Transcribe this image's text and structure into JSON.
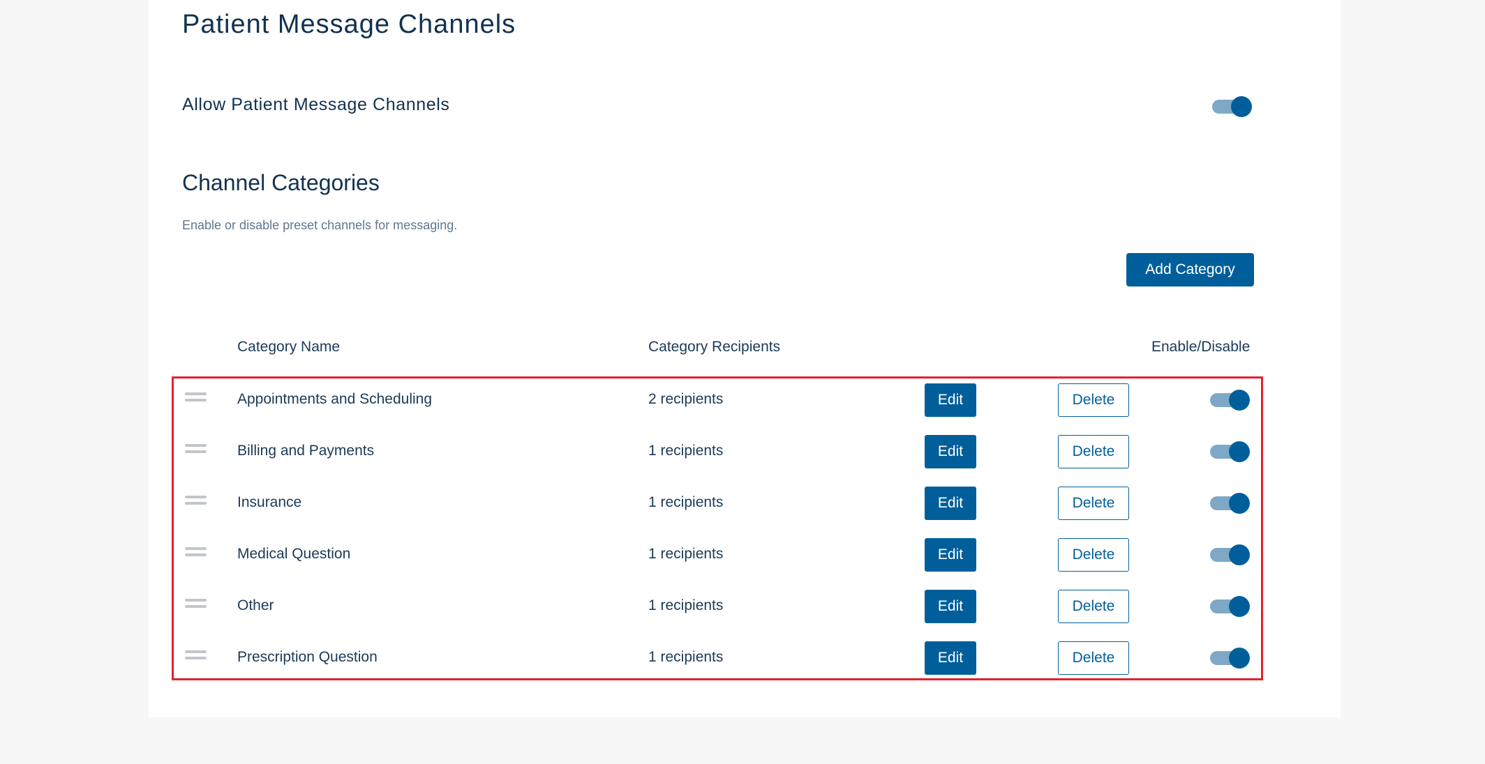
{
  "page": {
    "title": "Patient Message Channels"
  },
  "allow_setting": {
    "label": "Allow Patient Message Channels",
    "enabled": true
  },
  "categories_section": {
    "title": "Channel Categories",
    "description": "Enable or disable preset channels for messaging.",
    "add_button_label": "Add Category"
  },
  "table": {
    "headers": {
      "name": "Category Name",
      "recipients": "Category Recipients",
      "toggle": "Enable/Disable"
    },
    "edit_label": "Edit",
    "delete_label": "Delete",
    "rows": [
      {
        "name": "Appointments and Scheduling",
        "recipients": "2 recipients",
        "enabled": true
      },
      {
        "name": "Billing and Payments",
        "recipients": "1 recipients",
        "enabled": true
      },
      {
        "name": "Insurance",
        "recipients": "1 recipients",
        "enabled": true
      },
      {
        "name": "Medical Question",
        "recipients": "1 recipients",
        "enabled": true
      },
      {
        "name": "Other",
        "recipients": "1 recipients",
        "enabled": true
      },
      {
        "name": "Prescription Question",
        "recipients": "1 recipients",
        "enabled": true
      }
    ]
  },
  "colors": {
    "primary": "#005f9b",
    "toggle_track": "#7fa8c6",
    "highlight_border": "#e3212b",
    "page_background": "#f7f7f7",
    "panel_background": "#ffffff",
    "text": "#1b3a57"
  },
  "icons": {
    "drag_handle": "drag-handle-icon"
  }
}
